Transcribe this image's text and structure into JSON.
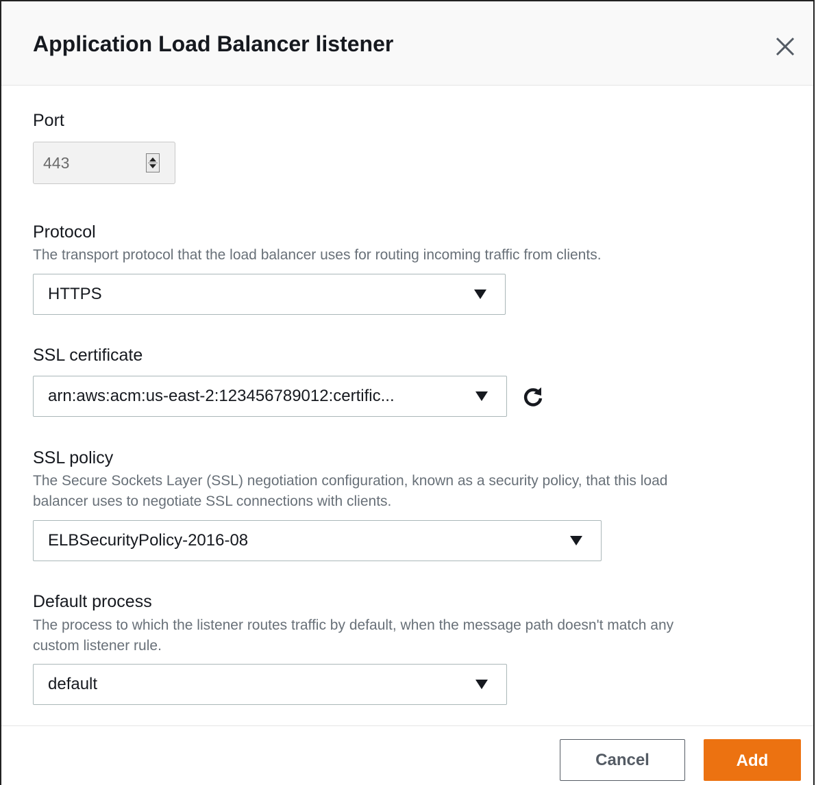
{
  "modal": {
    "title": "Application Load Balancer listener",
    "close_icon": "close-icon"
  },
  "port": {
    "label": "Port",
    "value": "443"
  },
  "protocol": {
    "label": "Protocol",
    "description": "The transport protocol that the load balancer uses for routing incoming traffic from clients.",
    "value": "HTTPS"
  },
  "ssl_certificate": {
    "label": "SSL certificate",
    "value": "arn:aws:acm:us-east-2:123456789012:certific...",
    "refresh_icon": "refresh-icon"
  },
  "ssl_policy": {
    "label": "SSL policy",
    "description_line1": "The Secure Sockets Layer (SSL) negotiation configuration, known as a security policy, that this load",
    "description_line2": "balancer uses to negotiate SSL connections with clients.",
    "value": "ELBSecurityPolicy-2016-08"
  },
  "default_process": {
    "label": "Default process",
    "description_line1": "The process to which the listener routes traffic by default, when the message path doesn't match any",
    "description_line2": "custom listener rule.",
    "value": "default"
  },
  "footer": {
    "cancel_label": "Cancel",
    "add_label": "Add"
  },
  "colors": {
    "primary_button": "#ec7211",
    "header_background": "#f9f9f9",
    "description_text": "#687078"
  }
}
